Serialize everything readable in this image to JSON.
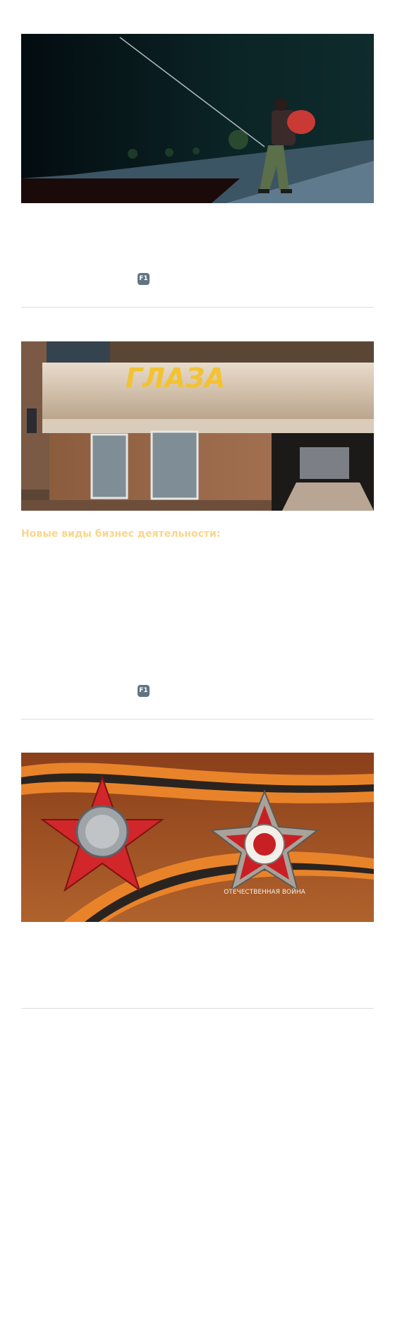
{
  "posts": [
    {
      "image": "fishing-game-screenshot",
      "hotkey": "F1"
    },
    {
      "image": "city-shop-building-screenshot",
      "image_sign": "ГЛАЗА",
      "subheading": "Новые виды бизнес деятельности:",
      "hotkey": "F1"
    },
    {
      "image": "soviet-war-orders-photo",
      "medal_text": "ОТЕЧЕСТВЕННАЯ ВОЙНА"
    }
  ],
  "colors": {
    "subheading": "#f9d68c",
    "badge": "#5f7584",
    "divider": "#dcdcdc"
  }
}
